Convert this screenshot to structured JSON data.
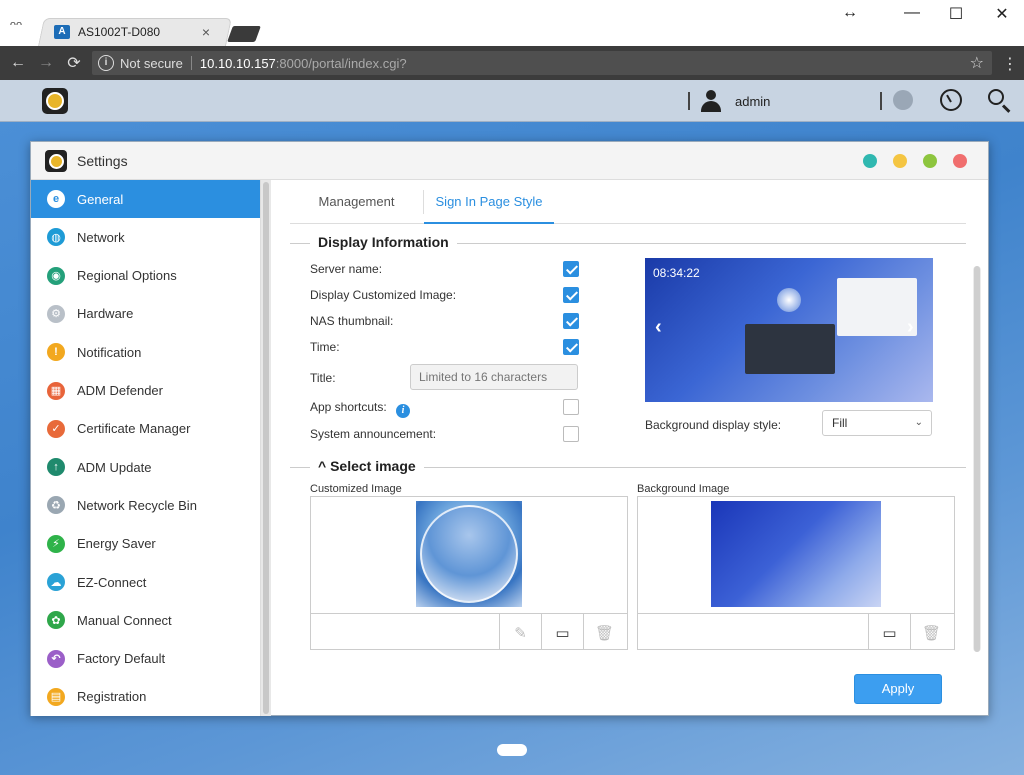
{
  "browser": {
    "tab_title": "AS1002T-D080",
    "tab_favicon": "A",
    "incognito_glyph": "ᴖᴖ",
    "close_glyph": "×",
    "security_label": "Not secure",
    "url_host": "10.10.10.157",
    "url_rest": ":8000/portal/index.cgi?",
    "icons": {
      "back": "←",
      "forward": "→",
      "reload": "⟳",
      "info": "i",
      "star": "☆",
      "menu": "⋮",
      "resize": "↔",
      "minimize": "—",
      "maximize": "☐",
      "window_close": "✕"
    }
  },
  "admbar": {
    "username": "admin"
  },
  "window": {
    "title": "Settings",
    "dots": [
      "#30b8b0",
      "#f4c542",
      "#8dc53e",
      "#f06e6e"
    ]
  },
  "sidebar": {
    "active_color": "#2b8fe0",
    "items": [
      {
        "label": "General",
        "icon": "general-icon",
        "glyph": "e",
        "color": "#2b8fe0"
      },
      {
        "label": "Network",
        "icon": "globe-icon",
        "glyph": "◍",
        "color": "#1e9bd6"
      },
      {
        "label": "Regional Options",
        "icon": "regional-icon",
        "glyph": "◉",
        "color": "#24a07a"
      },
      {
        "label": "Hardware",
        "icon": "hardware-icon",
        "glyph": "⚙",
        "color": "#b9c0c8"
      },
      {
        "label": "Notification",
        "icon": "notification-icon",
        "glyph": "!",
        "color": "#f2a81f"
      },
      {
        "label": "ADM Defender",
        "icon": "firewall-icon",
        "glyph": "▦",
        "color": "#e8643a"
      },
      {
        "label": "Certificate Manager",
        "icon": "certificate-icon",
        "glyph": "✓",
        "color": "#e86a3a"
      },
      {
        "label": "ADM Update",
        "icon": "update-icon",
        "glyph": "↑",
        "color": "#1f8a6d"
      },
      {
        "label": "Network Recycle Bin",
        "icon": "recycle-bin-icon",
        "glyph": "♻",
        "color": "#9aa7b2"
      },
      {
        "label": "Energy Saver",
        "icon": "energy-icon",
        "glyph": "⚡",
        "color": "#2fb34a"
      },
      {
        "label": "EZ-Connect",
        "icon": "cloud-icon",
        "glyph": "☁",
        "color": "#2aa2d6"
      },
      {
        "label": "Manual Connect",
        "icon": "manual-connect-icon",
        "glyph": "✿",
        "color": "#2fa74a"
      },
      {
        "label": "Factory Default",
        "icon": "undo-icon",
        "glyph": "↶",
        "color": "#9b5fc8"
      },
      {
        "label": "Registration",
        "icon": "registration-icon",
        "glyph": "▤",
        "color": "#f2a81f"
      }
    ]
  },
  "tabs": [
    {
      "label": "Management"
    },
    {
      "label": "Sign In Page Style"
    }
  ],
  "display_info": {
    "heading": "Display Information",
    "server_name_label": "Server name:",
    "custom_image_label": "Display Customized Image:",
    "thumbnail_label": "NAS thumbnail:",
    "time_label": "Time:",
    "title_label": "Title:",
    "title_placeholder": "Limited to 16 characters",
    "app_shortcuts_label": "App shortcuts:",
    "help_glyph": "i",
    "announcement_label": "System announcement:",
    "preview_time": "08:34:22",
    "prev_glyph": "‹",
    "next_glyph": "›",
    "bg_style_label": "Background display style:",
    "bg_style_value": "Fill",
    "chevron_glyph": "⌄"
  },
  "select_image": {
    "caret_glyph": "^",
    "heading": "Select image",
    "custom_label": "Customized Image",
    "background_label": "Background Image",
    "edit_glyph": "✎",
    "folder_glyph": "▭",
    "trash_glyph": "🗑"
  },
  "actions": {
    "apply": "Apply"
  }
}
